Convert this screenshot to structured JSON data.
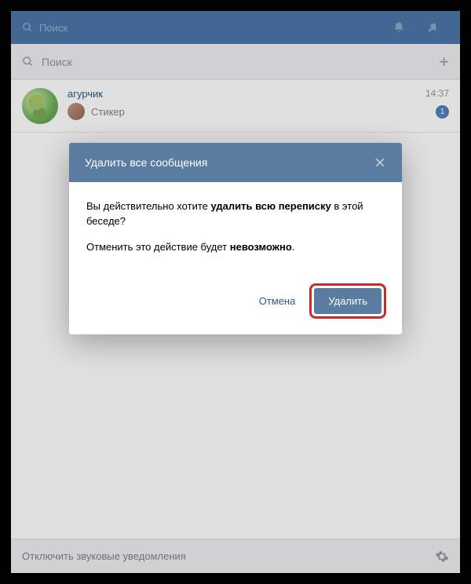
{
  "topbar": {
    "search": "Поиск"
  },
  "searchbar": {
    "placeholder": "Поиск"
  },
  "conversation": {
    "name": "агурчик",
    "time": "14:37",
    "message": "Стикер",
    "unread": "1"
  },
  "footer": {
    "mute": "Отключить звуковые уведомления"
  },
  "dialog": {
    "title": "Удалить все сообщения",
    "line1_a": "Вы действительно хотите ",
    "line1_b": "удалить всю переписку",
    "line1_c": " в этой беседе?",
    "line2_a": "Отменить это действие будет ",
    "line2_b": "невозможно",
    "line2_c": ".",
    "cancel": "Отмена",
    "confirm": "Удалить"
  }
}
